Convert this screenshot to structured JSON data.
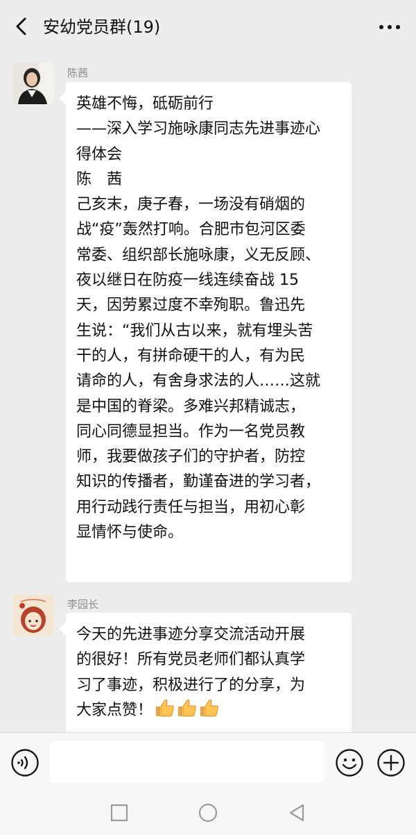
{
  "header": {
    "title": "安幼党员群(19)",
    "back_icon": "back-chevron-icon",
    "more_icon": "more-dots-icon"
  },
  "messages": [
    {
      "sender": "陈茜",
      "avatar": "photo-avatar-woman",
      "lines": [
        "英雄不悔，砥砺前行",
        "——深入学习施咏康同志先进事迹心",
        "得体会",
        "陈　茜",
        "己亥末，庚子春，一场没有硝烟的",
        "战“疫”轰然打响。合肥市包河区委",
        "常委、组织部长施咏康，义无反顾、",
        "夜以继日在防疫一线连续奋战 15",
        "天，因劳累过度不幸殉职。鲁迅先",
        "生说：“我们从古以来，就有埋头苦",
        "干的人，有拼命硬干的人，有为民",
        "请命的人，有舍身求法的人……这就",
        "是中国的脊梁。多难兴邦精诚志，",
        "同心同德显担当。作为一名党员教",
        "师，我要做孩子们的守护者，防控",
        "知识的传播者，勤谨奋进的学习者，",
        "用行动践行责任与担当，用初心彰",
        "显情怀与使命。"
      ]
    },
    {
      "sender": "李园长",
      "avatar": "cartoon-avatar-girl",
      "lines": [
        "今天的先进事迹分享交流活动开展",
        "的很好！所有党员老师们都认真学",
        "习了事迹，积极进行了的分享，为",
        "大家点赞！"
      ],
      "emoji": [
        "thumbs-up-icon",
        "thumbs-up-icon",
        "thumbs-up-icon"
      ]
    }
  ],
  "input_bar": {
    "placeholder": "",
    "voice_icon": "voice-icon",
    "emoji_icon": "emoji-smile-icon",
    "plus_icon": "plus-icon"
  },
  "system_nav": {
    "recent_icon": "square-recent-icon",
    "home_icon": "circle-home-icon",
    "back_icon": "triangle-back-icon"
  }
}
